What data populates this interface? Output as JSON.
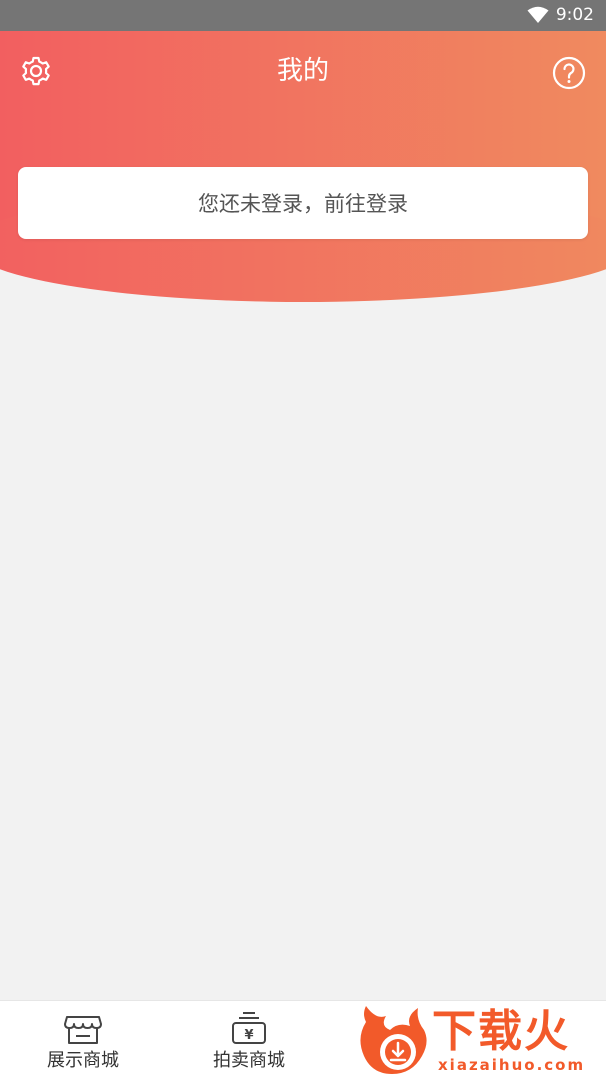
{
  "status_bar": {
    "time": "9:02",
    "wifi_icon": "wifi-icon"
  },
  "header": {
    "title": "我的",
    "settings_icon": "gear-icon",
    "help_icon": "question-circle-icon",
    "gradient_start": "#f25f60",
    "gradient_end": "#f08a5f"
  },
  "login_card": {
    "label": "您还未登录，前往登录"
  },
  "bottom_nav": {
    "items": [
      {
        "label": "展示商城",
        "icon": "storefront-icon"
      },
      {
        "label": "拍卖商城",
        "icon": "auction-icon"
      }
    ]
  },
  "watermark": {
    "text": "下载火",
    "sub": "xiazaihuo.com",
    "color": "#f25a2a"
  }
}
